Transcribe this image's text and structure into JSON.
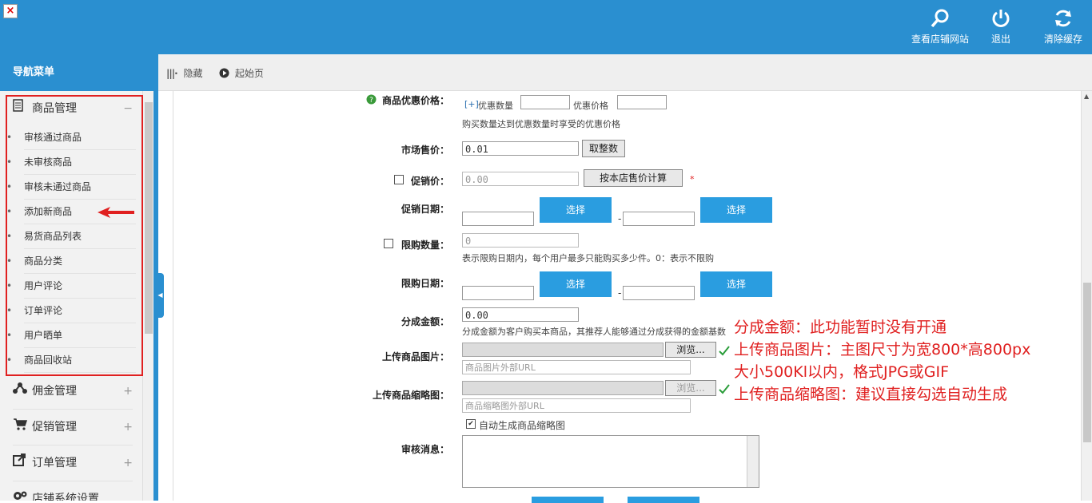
{
  "topbar": {
    "close_glyph": "×",
    "buttons": [
      {
        "label": "查看店铺网站",
        "icon": "search-icon"
      },
      {
        "label": "退出",
        "icon": "power-icon"
      },
      {
        "label": "清除缓存",
        "icon": "refresh-icon"
      }
    ]
  },
  "nav": {
    "title": "导航菜单",
    "groups": [
      {
        "label": "商品管理",
        "icon": "document-icon",
        "toggle": "−"
      },
      {
        "label": "佣金管理",
        "icon": "network-icon",
        "toggle": "+"
      },
      {
        "label": "促销管理",
        "icon": "cart-icon",
        "toggle": "+"
      },
      {
        "label": "订单管理",
        "icon": "export-icon",
        "toggle": "+"
      },
      {
        "label": "店铺系统设置",
        "icon": "gears-icon",
        "toggle": ""
      }
    ],
    "items": [
      "审核通过商品",
      "未审核商品",
      "审核未通过商品",
      "添加新商品",
      "易货商品列表",
      "商品分类",
      "用户评论",
      "订单评论",
      "用户晒单",
      "商品回收站"
    ]
  },
  "crumbbar": {
    "hide_label": "隐藏",
    "home_label": "起始页"
  },
  "form": {
    "discount_price": {
      "label": "商品优惠价格：",
      "add_link": "[+]",
      "qty_label": "优惠数量",
      "price_label": "优惠价格",
      "hint": "购买数量达到优惠数量时享受的优惠价格"
    },
    "market_price": {
      "label": "市场售价：",
      "value": "0.01",
      "button": "取整数"
    },
    "promo_price": {
      "label": "促销价：",
      "value": "0.00",
      "button": "按本店售价计算",
      "required": "*"
    },
    "promo_date": {
      "label": "促销日期：",
      "select": "选择",
      "dash": "-"
    },
    "limit_qty": {
      "label": "限购数量：",
      "value": "0",
      "hint": "表示限购日期内，每个用户最多只能购买多少件。0：表示不限购"
    },
    "limit_date": {
      "label": "限购日期：",
      "select": "选择",
      "dash": "-"
    },
    "split_amount": {
      "label": "分成金额：",
      "value": "0.00",
      "hint": "分成金额为客户购买本商品，其推荐人能够通过分成获得的金额基数"
    },
    "upload_image": {
      "label": "上传商品图片：",
      "browse": "浏览...",
      "url_placeholder": "商品图片外部URL"
    },
    "upload_thumb": {
      "label": "上传商品缩略图：",
      "browse": "浏览...",
      "url_placeholder": "商品缩略图外部URL",
      "auto_label": "自动生成商品缩略图"
    },
    "audit_msg": {
      "label": "审核消息："
    }
  },
  "annotations": [
    "分成金额：此功能暂时没有开通",
    "上传商品图片：主图尺寸为宽800*高800px",
    "大小500Kl以内，格式JPG或GIF",
    "上传商品缩略图：建议直接勾选自动生成"
  ],
  "colors": {
    "primary": "#2a8fd0",
    "button_blue": "#2a9de0",
    "annotation_red": "#e02020",
    "check_green": "#2a9d3a"
  }
}
